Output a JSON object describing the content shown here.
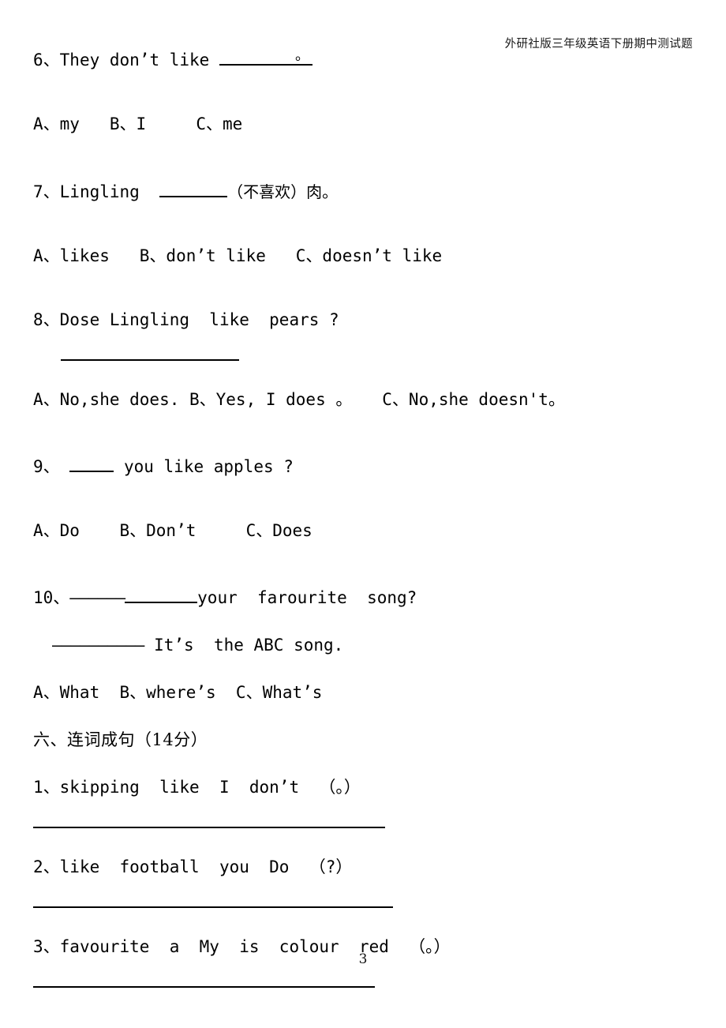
{
  "document": {
    "header_title": "外研社版三年级英语下册期中测试题",
    "page_number": "3"
  },
  "multiple_choice": {
    "questions": [
      {
        "number": "6、",
        "stem_before_blank": "They don’t like ",
        "blank_mark": "。",
        "stem_after_blank": "",
        "options_line": "A、my   B、I     C、me"
      },
      {
        "number": "7、",
        "stem_before_blank": "Lingling  ",
        "stem_after_blank": "（不喜欢）肉。",
        "options_line": "A、likes   B、don’t like   C、doesn’t like"
      },
      {
        "number": "8、",
        "stem": "Dose Lingling  like  pears ?",
        "answer_rule": true,
        "options_line": "A、No,she does. B、Yes, I does 。   C、No,she doesn't。"
      },
      {
        "number": "9、",
        "stem_before_blank": " ",
        "stem_after_blank": " you like apples ?",
        "options_line": "A、Do    B、Don’t     C、Does"
      },
      {
        "number": "10、",
        "dash_run": "——————",
        "stem_after_blank": "your  farourite  song?",
        "answer_dash_run": "——————————",
        "answer_text": " It’s  the ABC song.",
        "options_line": "A、What  B、where’s  C、What’s"
      }
    ]
  },
  "section_six": {
    "heading": "六、连词成句（14分）",
    "items": [
      {
        "number": "1、",
        "text": "skipping  like  I  don’t  （。）"
      },
      {
        "number": "2、",
        "text": "like  football  you  Do  （?）"
      },
      {
        "number": "3、",
        "text": "favourite  a  My  is  colour  red  （。）"
      }
    ]
  }
}
